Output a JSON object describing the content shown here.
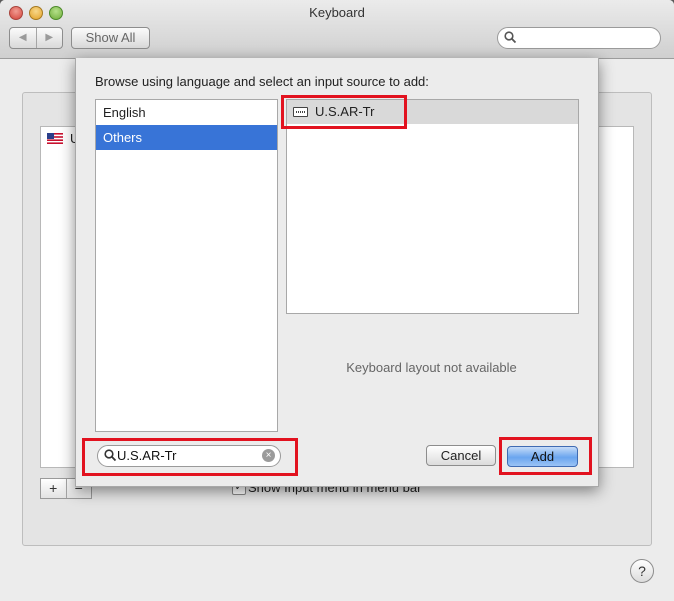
{
  "window": {
    "title": "Keyboard",
    "nav_back": "◀",
    "nav_forward": "▶",
    "show_all_label": "Show All",
    "search_placeholder": ""
  },
  "background": {
    "list_items": [
      {
        "flag_label": "U"
      }
    ],
    "add_button": "+",
    "remove_button": "−",
    "show_input_menu_label": "Show Input menu in menu bar",
    "help_label": "?"
  },
  "sheet": {
    "prompt": "Browse using language and select an input source to add:",
    "languages": [
      {
        "label": "English",
        "selected": false
      },
      {
        "label": "Others",
        "selected": true
      }
    ],
    "sources": [
      {
        "label": "U.S.AR-Tr",
        "icon": "keyboard-icon"
      }
    ],
    "status_text": "Keyboard layout not available",
    "search_value": "U.S.AR-Tr",
    "cancel_label": "Cancel",
    "add_label": "Add"
  },
  "colors": {
    "selection": "#3874d7",
    "highlight": "#e2121f",
    "default_button": "#6aa5ef"
  }
}
